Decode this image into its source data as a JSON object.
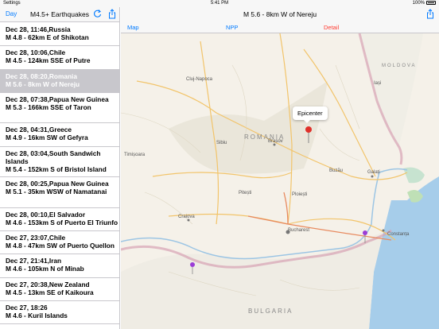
{
  "status_bar": {
    "left": "Settings",
    "time": "5:41 PM",
    "battery": "100%"
  },
  "sidebar": {
    "day_button": "Day",
    "title": "M4.5+ Earthquakes",
    "refresh_icon": "refresh-icon",
    "share_icon": "share-icon",
    "items": [
      {
        "time": "Dec 28, 11:46,Russia",
        "detail": "M 4.8 - 62km E of Shikotan",
        "selected": false
      },
      {
        "time": "Dec 28, 10:06,Chile",
        "detail": "M 4.5 - 124km SSE of Putre",
        "selected": false
      },
      {
        "time": "Dec 28, 08:20,Romania",
        "detail": "M 5.6 - 8km W of Nereju",
        "selected": true
      },
      {
        "time": "Dec 28, 07:38,Papua New Guinea",
        "detail": "M 5.3 - 166km SSE of Taron",
        "selected": false
      },
      {
        "time": "Dec 28, 04:31,Greece",
        "detail": "M 4.9 - 16km SW of Gefyra",
        "selected": false
      },
      {
        "time": "Dec 28, 03:04,South Sandwich Islands",
        "detail": "M 5.4 - 152km S of Bristol Island",
        "selected": false
      },
      {
        "time": "Dec 28, 00:25,Papua New Guinea",
        "detail": "M 5.1 - 35km WSW of Namatanai",
        "selected": false
      },
      {
        "time": "Dec 28, 00:10,El Salvador",
        "detail": "M 4.6 - 153km S of Puerto El Triunfo",
        "selected": false
      },
      {
        "time": "Dec 27, 23:07,Chile",
        "detail": "M 4.8 - 47km SW of Puerto Quellon",
        "selected": false
      },
      {
        "time": "Dec 27, 21:41,Iran",
        "detail": "M 4.6 - 105km N of Minab",
        "selected": false
      },
      {
        "time": "Dec 27, 20:38,New Zealand",
        "detail": "M 4.5 - 13km SE of Kaikoura",
        "selected": false
      },
      {
        "time": "Dec 27, 18:26",
        "detail": "M 4.6 - Kuril Islands",
        "selected": false
      }
    ]
  },
  "main": {
    "title": "M 5.6 - 8km W of Nereju",
    "share_icon": "share-icon",
    "segments": {
      "map": "Map",
      "npp": "NPP",
      "detail": "Detail"
    },
    "callout": "Epicenter",
    "map_labels": {
      "romania": "ROMANIA",
      "bulgaria": "BULGARIA",
      "moldova": "MOLDOVA",
      "cluj": "Cluj-Napoca",
      "brasov": "Brașov",
      "bucharest": "Bucharest",
      "craiova": "Craiova",
      "constanta": "Constanța",
      "galati": "Galați",
      "iasi": "Iași",
      "sibiu": "Sibiu",
      "pitesti": "Pitești",
      "ploiesti": "Ploiești",
      "buzau": "Buzău",
      "timisoara": "Timișoara"
    }
  }
}
